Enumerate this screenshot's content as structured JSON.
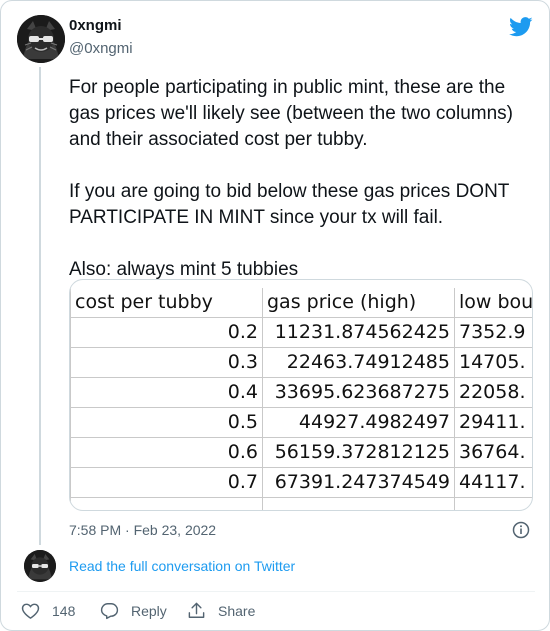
{
  "author": {
    "display_name": "0xngmi",
    "handle": "@0xngmi"
  },
  "tweet": {
    "text": "For people participating in public mint, these are the gas prices we'll likely see (between the two columns) and their associated cost per tubby.\n\nIf you are going to bid below these gas prices DONT PARTICIPATE IN MINT since your tx will fail.\n\nAlso: always mint 5 tubbies",
    "timestamp": "7:58 PM · Feb 23, 2022"
  },
  "spreadsheet": {
    "headers": [
      "cost per tubby",
      "gas price (high)",
      "low bou"
    ],
    "rows": [
      [
        "0.2",
        "11231.874562425",
        "7352.9"
      ],
      [
        "0.3",
        "22463.74912485",
        "14705."
      ],
      [
        "0.4",
        "33695.623687275",
        "22058."
      ],
      [
        "0.5",
        "44927.4982497",
        "29411."
      ],
      [
        "0.6",
        "56159.372812125",
        "36764."
      ],
      [
        "0.7",
        "67391.247374549",
        "44117."
      ]
    ]
  },
  "footer": {
    "read_link": "Read the full conversation on Twitter"
  },
  "actions": {
    "like_count": "148",
    "reply_label": "Reply",
    "share_label": "Share"
  },
  "colors": {
    "accent": "#1d9bf0",
    "secondary_text": "#536471",
    "border": "#cfd9de"
  },
  "icons": [
    "twitter-bird-icon",
    "info-icon",
    "heart-icon",
    "reply-icon",
    "share-icon"
  ]
}
